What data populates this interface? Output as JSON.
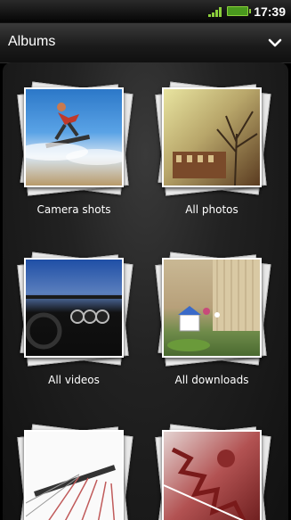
{
  "status_bar": {
    "time": "17:39",
    "signal_icon": "signal-bars-icon",
    "battery_icon": "battery-icon",
    "accent_color": "#8ccf3c"
  },
  "header": {
    "title": "Albums",
    "dropdown_icon": "chevron-down-icon"
  },
  "albums": [
    {
      "label": "Camera shots"
    },
    {
      "label": "All photos"
    },
    {
      "label": "All videos"
    },
    {
      "label": "All downloads"
    },
    {
      "label": ""
    },
    {
      "label": ""
    }
  ]
}
